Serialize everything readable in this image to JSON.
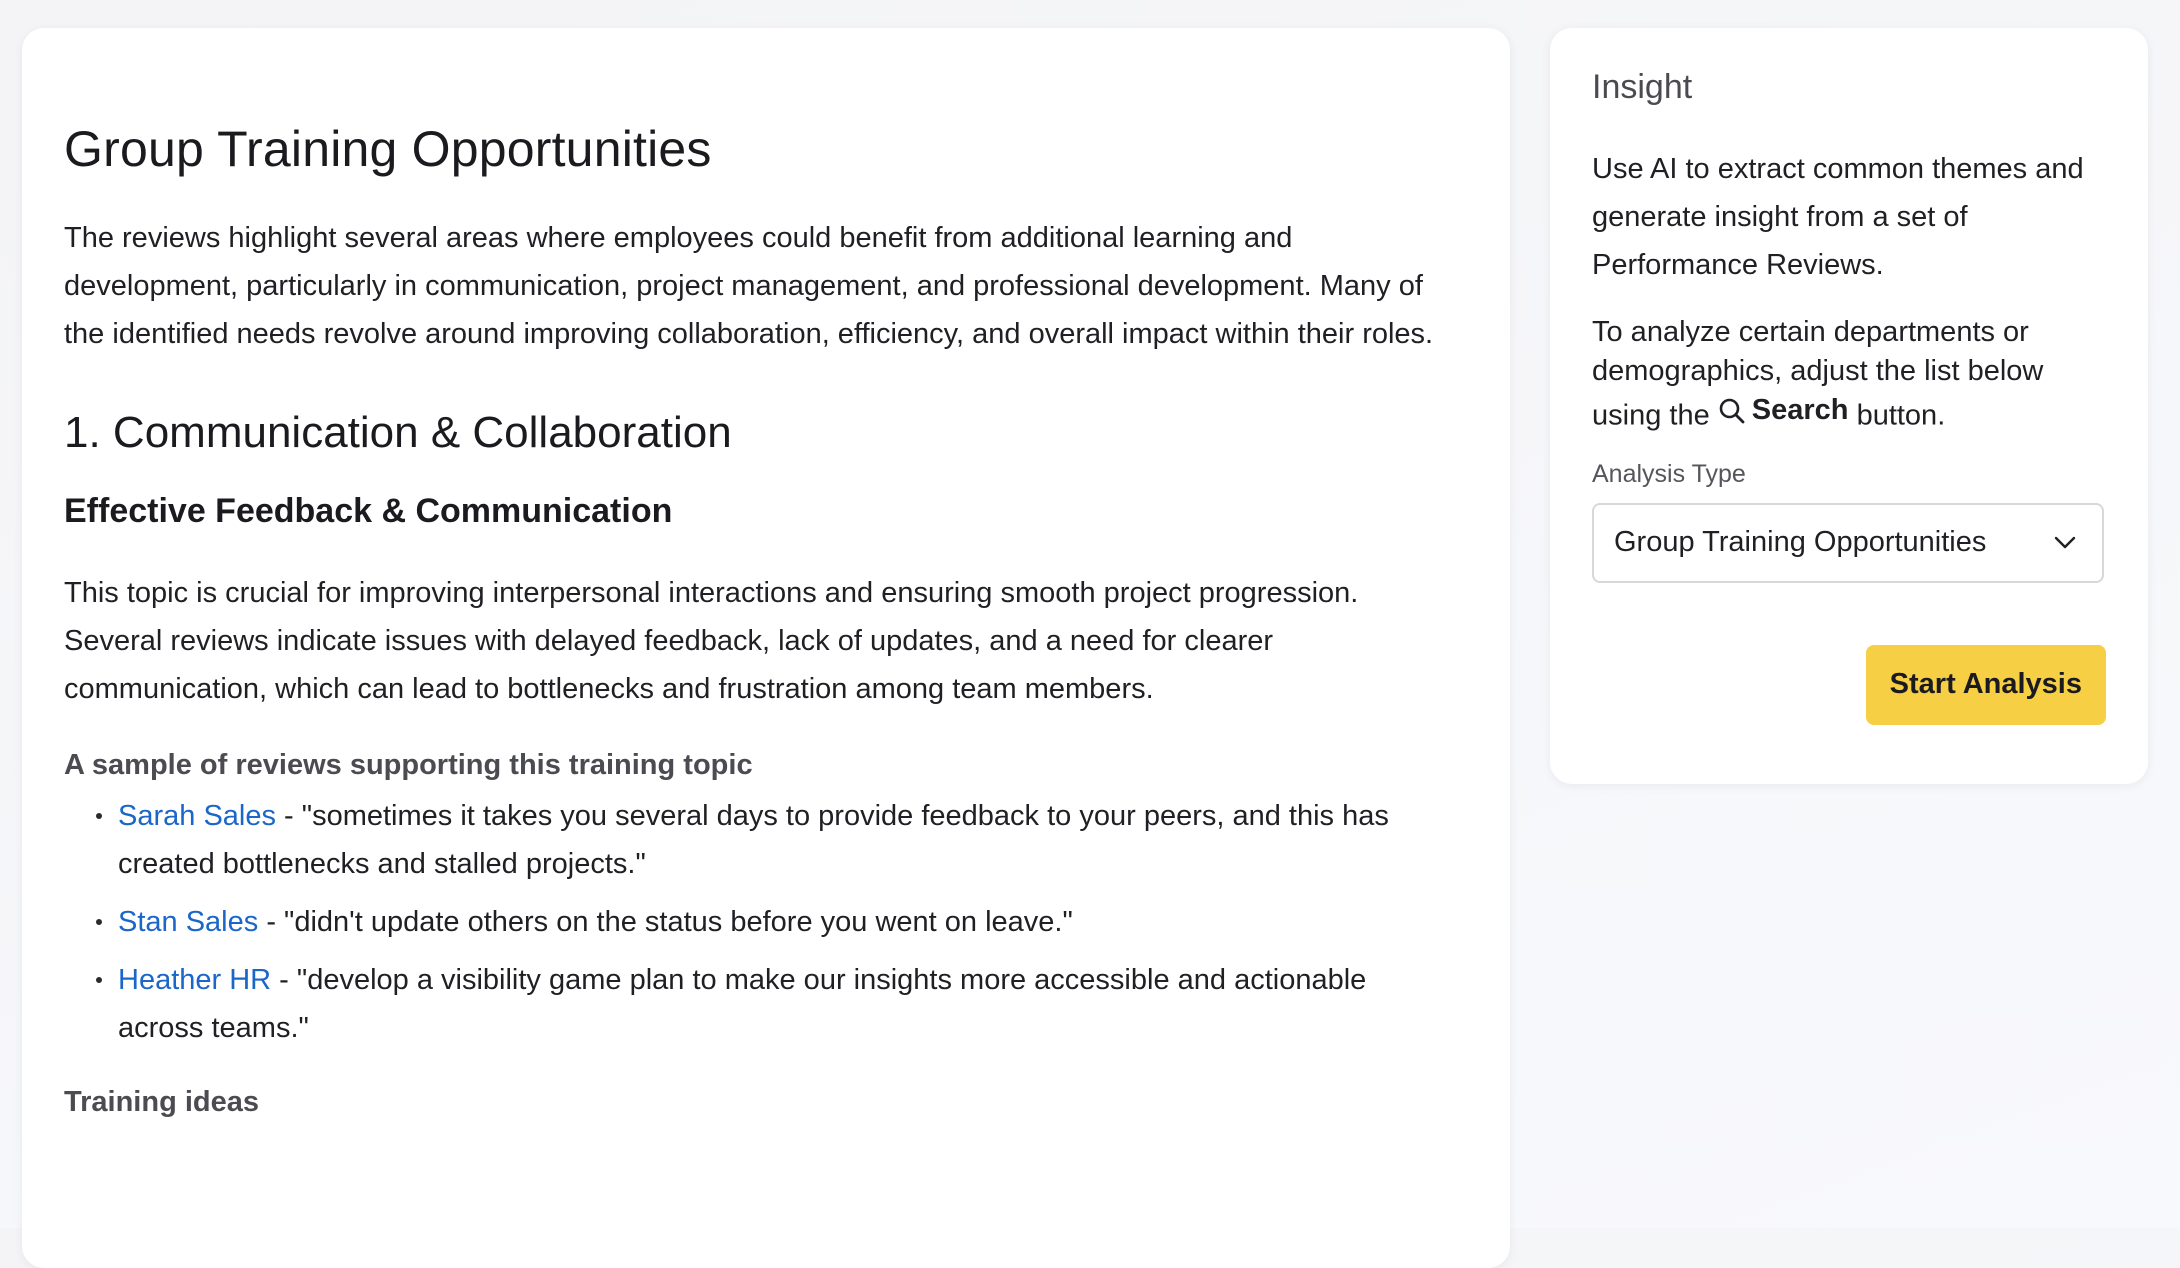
{
  "main": {
    "title": "Group Training Opportunities",
    "intro": "The reviews highlight several areas where employees could benefit from additional learning and development, particularly in communication, project management, and professional development. Many of the identified needs revolve around improving collaboration, efficiency, and overall impact within their roles.",
    "section": {
      "heading": "1. Communication & Collaboration",
      "subheading": "Effective Feedback & Communication",
      "description": "This topic is crucial for improving interpersonal interactions and ensuring smooth project progression. Several reviews indicate issues with delayed feedback, lack of updates, and a need for clearer communication, which can lead to bottlenecks and frustration among team members.",
      "sample_heading": "A sample of reviews supporting this training topic",
      "reviews": [
        {
          "name": "Sarah Sales",
          "separator": " - ",
          "quote": "\"sometimes it takes you several days to provide feedback to your peers, and this has created bottlenecks and stalled projects.\""
        },
        {
          "name": "Stan Sales",
          "separator": " - ",
          "quote": "\"didn't update others on the status before you went on leave.\""
        },
        {
          "name": "Heather HR",
          "separator": " - ",
          "quote": "\"develop a visibility game plan to make our insights more accessible and actionable across teams.\""
        }
      ],
      "training_heading": "Training ideas"
    }
  },
  "insight": {
    "title": "Insight",
    "description": "Use AI to extract common themes and generate insight from a set of Performance Reviews.",
    "instruction_before": "To analyze certain departments or demographics, adjust the list below using the",
    "search_label": "Search",
    "instruction_after": "button.",
    "analysis_type_label": "Analysis Type",
    "analysis_type_value": "Group Training Opportunities",
    "start_button": "Start Analysis"
  },
  "colors": {
    "link": "#1a66c9",
    "primary_button": "#f7cf45"
  },
  "icons": {
    "search": "search-icon",
    "dropdown": "chevron-down-icon"
  }
}
